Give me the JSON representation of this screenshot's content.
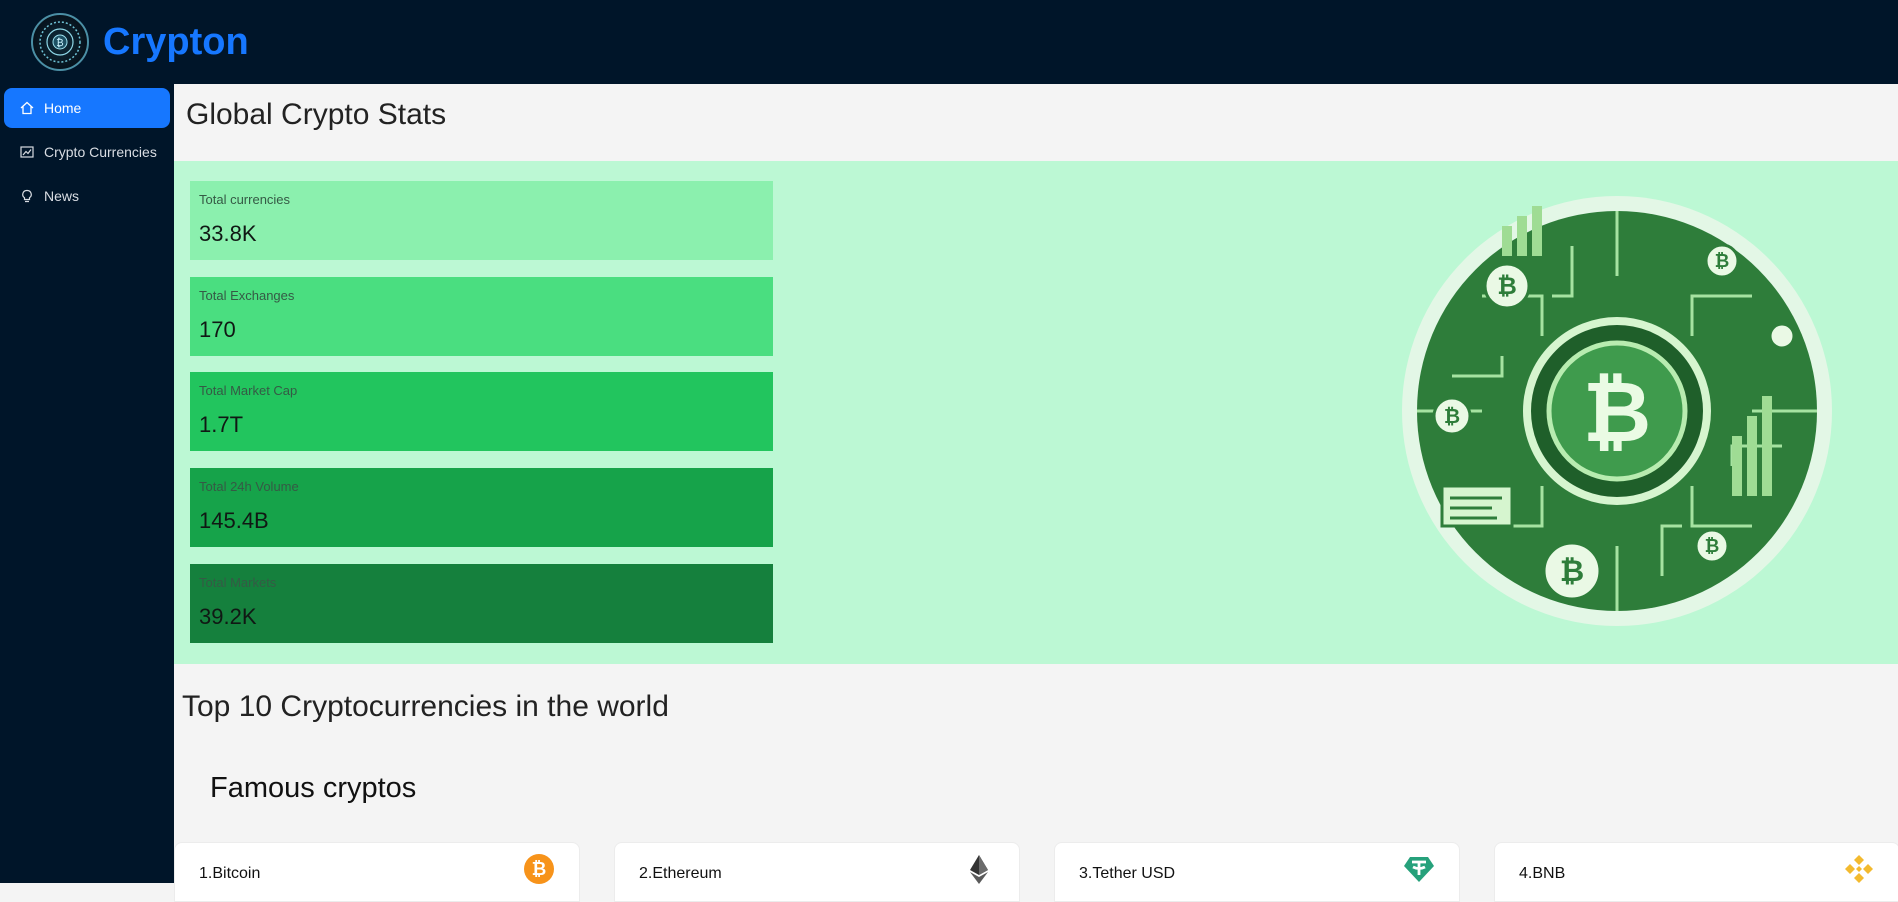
{
  "app": {
    "title": "Crypton",
    "logo_icon": "crypton-logo-icon"
  },
  "sidebar": {
    "items": [
      {
        "label": "Home",
        "icon": "home-icon",
        "active": true
      },
      {
        "label": "Crypto Currencies",
        "icon": "chart-icon",
        "active": false
      },
      {
        "label": "News",
        "icon": "bulb-icon",
        "active": false
      }
    ]
  },
  "main": {
    "title": "Global Crypto Stats",
    "stats": [
      {
        "label": "Total currencies",
        "value": "33.8K",
        "color": "#8bf0ae"
      },
      {
        "label": "Total Exchanges",
        "value": "170",
        "color": "#4ade80"
      },
      {
        "label": "Total Market Cap",
        "value": "1.7T",
        "color": "#22c55e"
      },
      {
        "label": "Total 24h Volume",
        "value": "145.4B",
        "color": "#16a34a"
      },
      {
        "label": "Total Markets",
        "value": "39.2K",
        "color": "#15803d"
      }
    ],
    "art_icon": "bitcoin-circuit-illustration",
    "section_title": "Top 10 Cryptocurrencies in the world",
    "sub_title": "Famous cryptos",
    "cards": [
      {
        "name": "1.Bitcoin",
        "icon": "bitcoin-icon",
        "color": "#f7931a"
      },
      {
        "name": "2.Ethereum",
        "icon": "ethereum-icon",
        "color": "#343434"
      },
      {
        "name": "3.Tether USD",
        "icon": "tether-icon",
        "color": "#26a17b"
      },
      {
        "name": "4.BNB",
        "icon": "bnb-icon",
        "color": "#f3ba2f"
      }
    ]
  },
  "colors": {
    "header_bg": "#001529",
    "accent": "#1677ff",
    "panel_bg": "#bcf8d4"
  }
}
